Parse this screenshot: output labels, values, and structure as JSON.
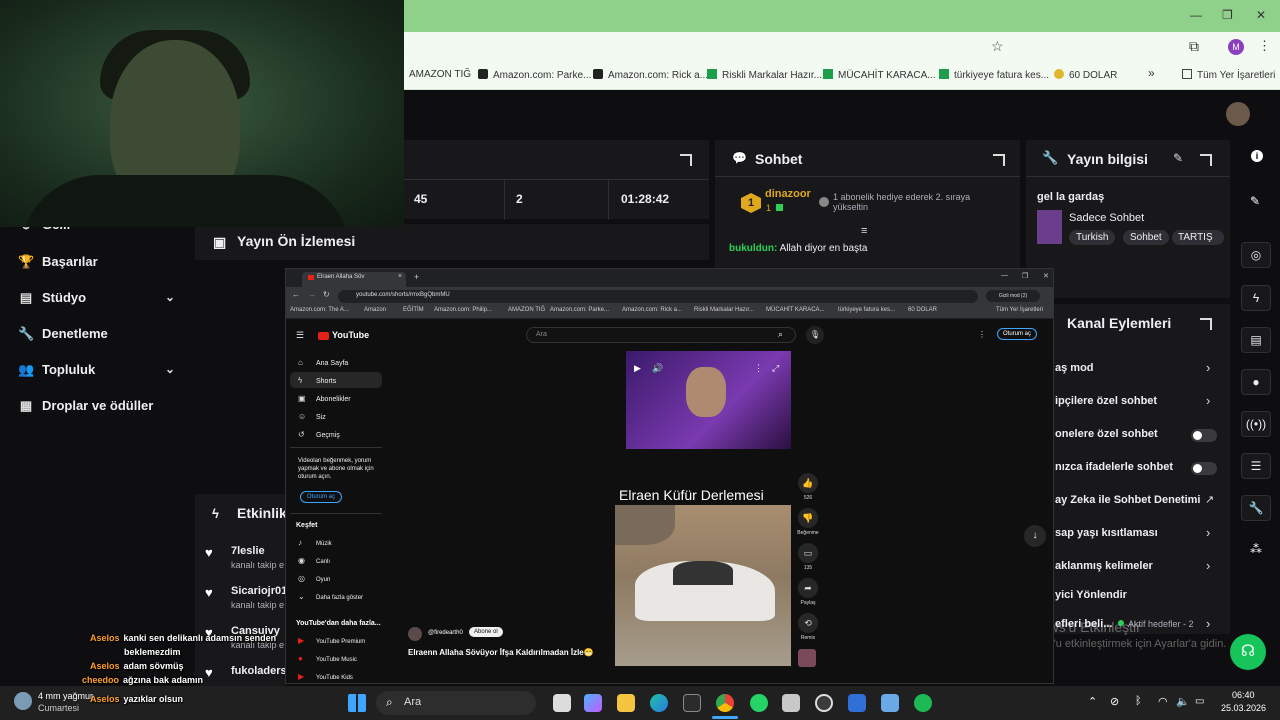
{
  "browser": {
    "bookmarks": [
      "AMAZON TIĞ",
      "Amazon.com: Parke...",
      "Amazon.com: Rick a...",
      "Riskli Markalar Hazır...",
      "MÜCAHİT KARACA...",
      "türkiyeye fatura kes...",
      "60 DOLAR"
    ],
    "all_bookmarks": "Tüm Yer İşaretleri",
    "profile_letter": "M"
  },
  "stats": {
    "viewers": "45",
    "followers": "2",
    "uptime": "01:28:42"
  },
  "sidebar": {
    "items": [
      {
        "label": "Gelir",
        "icon": "dollar-icon"
      },
      {
        "label": "Başarılar",
        "icon": "trophy-icon"
      },
      {
        "label": "Stüdyo",
        "icon": "studio-icon"
      },
      {
        "label": "Denetleme",
        "icon": "wrench-icon"
      },
      {
        "label": "Topluluk",
        "icon": "people-icon"
      },
      {
        "label": "Droplar ve ödüller",
        "icon": "gift-icon"
      }
    ]
  },
  "preview": {
    "title": "Yayın Ön İzlemesi"
  },
  "chat": {
    "title": "Sohbet",
    "hype": {
      "user": "dinazoor",
      "rank": "1",
      "count": "1",
      "note": "1 abonelik hediye ederek 2. sıraya yükseltin"
    },
    "message": {
      "user": "bukuldun:",
      "text": "Allah diyor en başta"
    }
  },
  "stream_info": {
    "title": "Yayın bilgisi",
    "stream_title": "gel la gardaş",
    "category": "Sadece Sohbet",
    "tags": [
      "Turkish",
      "Sohbet",
      "TARTIŞ"
    ]
  },
  "channel_actions": {
    "title": "Kanal Eylemleri",
    "rows": [
      {
        "label": "aş mod",
        "kind": "chevron"
      },
      {
        "label": "ipçilere özel sohbet",
        "kind": "chevron"
      },
      {
        "label": "onelere özel sohbet",
        "kind": "toggle"
      },
      {
        "label": "nızca ifadelerle sohbet",
        "kind": "toggle"
      },
      {
        "label": "ay Zeka ile Sohbet Denetimi",
        "kind": "link"
      },
      {
        "label": "sap yaşı kısıtlaması",
        "kind": "chevron"
      },
      {
        "label": "aklanmış kelimeler",
        "kind": "chevron"
      },
      {
        "label": "yici Yönlendir",
        "kind": "none"
      },
      {
        "label": "efleri beli...",
        "kind": "chevron",
        "extra": "Aktif hedefler - 2"
      }
    ]
  },
  "activity": {
    "title": "Etkinlik",
    "items": [
      {
        "user": "7leslie",
        "sub": "kanalı takip e"
      },
      {
        "user": "Sicariojr01",
        "sub": "kanalı takip e"
      },
      {
        "user": "Cansuivy",
        "sub": "kanalı takip e"
      },
      {
        "user": "fukoladers",
        "sub": ""
      }
    ]
  },
  "youtube": {
    "tab_title": "Elraen Allaha Söv",
    "url": "youtube.com/shorts/rmxBgQbmMU",
    "incognito": "Gizli mod (2)",
    "bookmarks": [
      "Amazon.com: The A...",
      "Amazon",
      "EĞİTİM",
      "Amazon.com: Philip...",
      "AMAZON TIĞ",
      "Amazon.com: Parke...",
      "Amazon.com: Rick a...",
      "Riskli Markalar Hazır...",
      "MÜCAHİT KARACA...",
      "türkiyeye fatura kes...",
      "60 DOLAR",
      "Tüm Yer İşaretleri"
    ],
    "logo": "YouTube",
    "search_placeholder": "Ara",
    "signin": "Oturum aç",
    "nav": [
      "Ana Sayfa",
      "Shorts",
      "Abonelikler",
      "Siz",
      "Geçmiş"
    ],
    "signin_prompt": "Videoları beğenmek, yorum yapmak ve abone olmak için oturum açın.",
    "signin_button": "Oturum aç",
    "explore_title": "Keşfet",
    "explore": [
      "Müzik",
      "Canlı",
      "Oyun",
      "Daha fazla göster"
    ],
    "more_title": "YouTube'dan daha fazla...",
    "more": [
      "YouTube Premium",
      "YouTube Music",
      "YouTube Kids"
    ],
    "short_caption": "Elraen Küfür Derlemesi",
    "channel": "@firedearth0",
    "subscribe": "Abone ol",
    "video_title": "Elraenn Allaha Sövüyor İfşa Kaldırılmadan İzle😁",
    "likes": "526",
    "dislike_label": "Beğenme",
    "comments": "135",
    "share_label": "Paylaş",
    "remix_label": "Remix"
  },
  "overlay_chat": [
    {
      "user": "Aselos",
      "text": "kanki sen delikanlı adamsın senden"
    },
    {
      "user": "",
      "text": "beklemezdim"
    },
    {
      "user": "Aselos",
      "text": "adam sövmüş"
    },
    {
      "user": "cheedoo",
      "text": "ağzına bak adamın"
    },
    {
      "user": "Aselos",
      "text": "yazıklar olsun"
    }
  ],
  "watermark": {
    "line1": "Windows'u Etkinleştir",
    "line2": "Windows'u etkinleştirmek için Ayarlar'a gidin."
  },
  "taskbar": {
    "weather": "4 mm yağmur",
    "weather_day": "Cumartesi",
    "search": "Ara",
    "time": "06:40",
    "date": "25.03.2026"
  }
}
